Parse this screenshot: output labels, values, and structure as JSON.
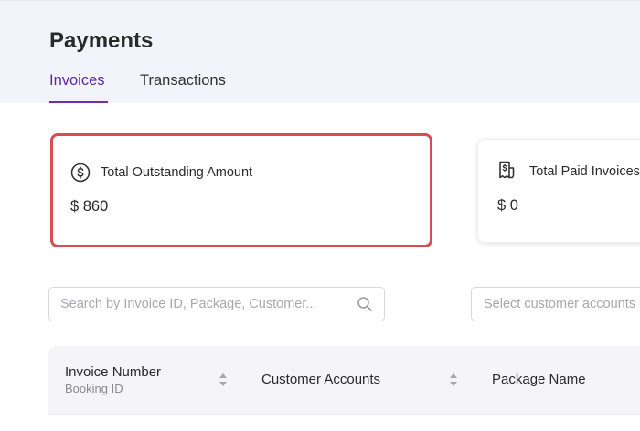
{
  "header": {
    "title": "Payments",
    "tabs": [
      {
        "label": "Invoices",
        "active": true
      },
      {
        "label": "Transactions",
        "active": false
      }
    ]
  },
  "cards": {
    "outstanding": {
      "icon": "dollar-circle-icon",
      "label": "Total Outstanding Amount",
      "value": "$ 860"
    },
    "paid": {
      "icon": "receipt-icon",
      "label": "Total Paid Invoices",
      "value": "$ 0"
    }
  },
  "filters": {
    "search": {
      "placeholder": "Search by Invoice ID, Package, Customer...",
      "value": "",
      "icon": "search-icon"
    },
    "customer_select": {
      "placeholder": "Select customer accounts"
    }
  },
  "table": {
    "columns": [
      {
        "title": "Invoice Number",
        "subtitle": "Booking ID",
        "sortable": true
      },
      {
        "title": "Customer Accounts",
        "subtitle": "",
        "sortable": true
      },
      {
        "title": "Package Name",
        "subtitle": "",
        "sortable": false
      }
    ]
  },
  "colors": {
    "accent": "#6b2fb0",
    "highlight_border": "#d84c53",
    "header_bg": "#f3f3fb"
  }
}
